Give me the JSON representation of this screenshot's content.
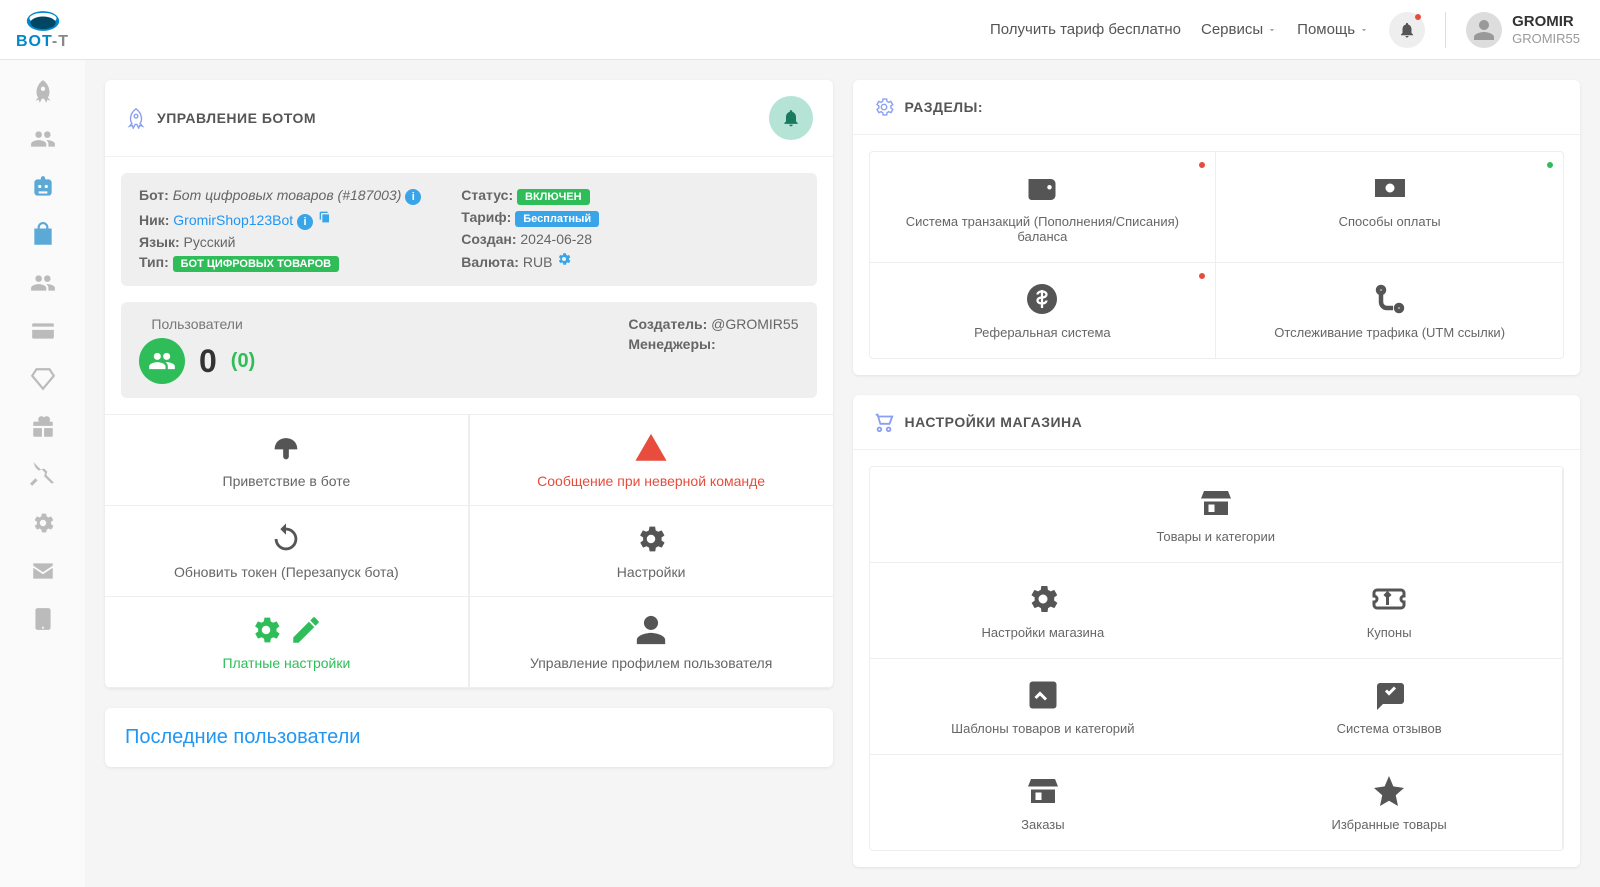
{
  "header": {
    "free_tariff": "Получить тариф бесплатно",
    "services": "Сервисы",
    "help": "Помощь",
    "user_primary": "GROMIR",
    "user_secondary": "GROMIR55"
  },
  "bot_card": {
    "title": "УПРАВЛЕНИЕ БОТОМ",
    "bot_label": "Бот:",
    "bot_name": "Бот цифровых товаров (#187003)",
    "nick_label": "Ник:",
    "nick_value": "GromirShop123Bot",
    "lang_label": "Язык:",
    "lang_value": "Русский",
    "type_label": "Тип:",
    "type_badge": "БОТ ЦИФРОВЫХ ТОВАРОВ",
    "status_label": "Статус:",
    "status_badge": "ВКЛЮЧЕН",
    "tariff_label": "Тариф:",
    "tariff_badge": "Бесплатный",
    "created_label": "Создан:",
    "created_value": "2024-06-28",
    "currency_label": "Валюта:",
    "currency_value": "RUB",
    "users_label": "Пользователи",
    "users_count": "0",
    "users_paren": "(0)",
    "creator_label": "Создатель:",
    "creator_value": "@GROMIR55",
    "managers_label": "Менеджеры:"
  },
  "tiles": {
    "greeting": "Приветствие в боте",
    "wrong_cmd": "Сообщение при неверной команде",
    "refresh_token": "Обновить токен (Перезапуск бота)",
    "settings": "Настройки",
    "paid_settings": "Платные настройки",
    "profile_mgmt": "Управление профилем пользователя"
  },
  "last_users_title": "Последние пользователи",
  "sections": {
    "title": "РАЗДЕЛЫ:",
    "transactions": "Система транзакций (Пополнения/Списания) баланса",
    "payments": "Способы оплаты",
    "referral": "Реферальная система",
    "utm": "Отслеживание трафика (UTM ссылки)"
  },
  "shop": {
    "title": "НАСТРОЙКИ МАГАЗИНА",
    "products": "Товары и категории",
    "settings": "Настройки магазина",
    "coupons": "Купоны",
    "templates": "Шаблоны товаров и категорий",
    "reviews": "Система отзывов",
    "orders": "Заказы",
    "favorites": "Избранные товары"
  }
}
